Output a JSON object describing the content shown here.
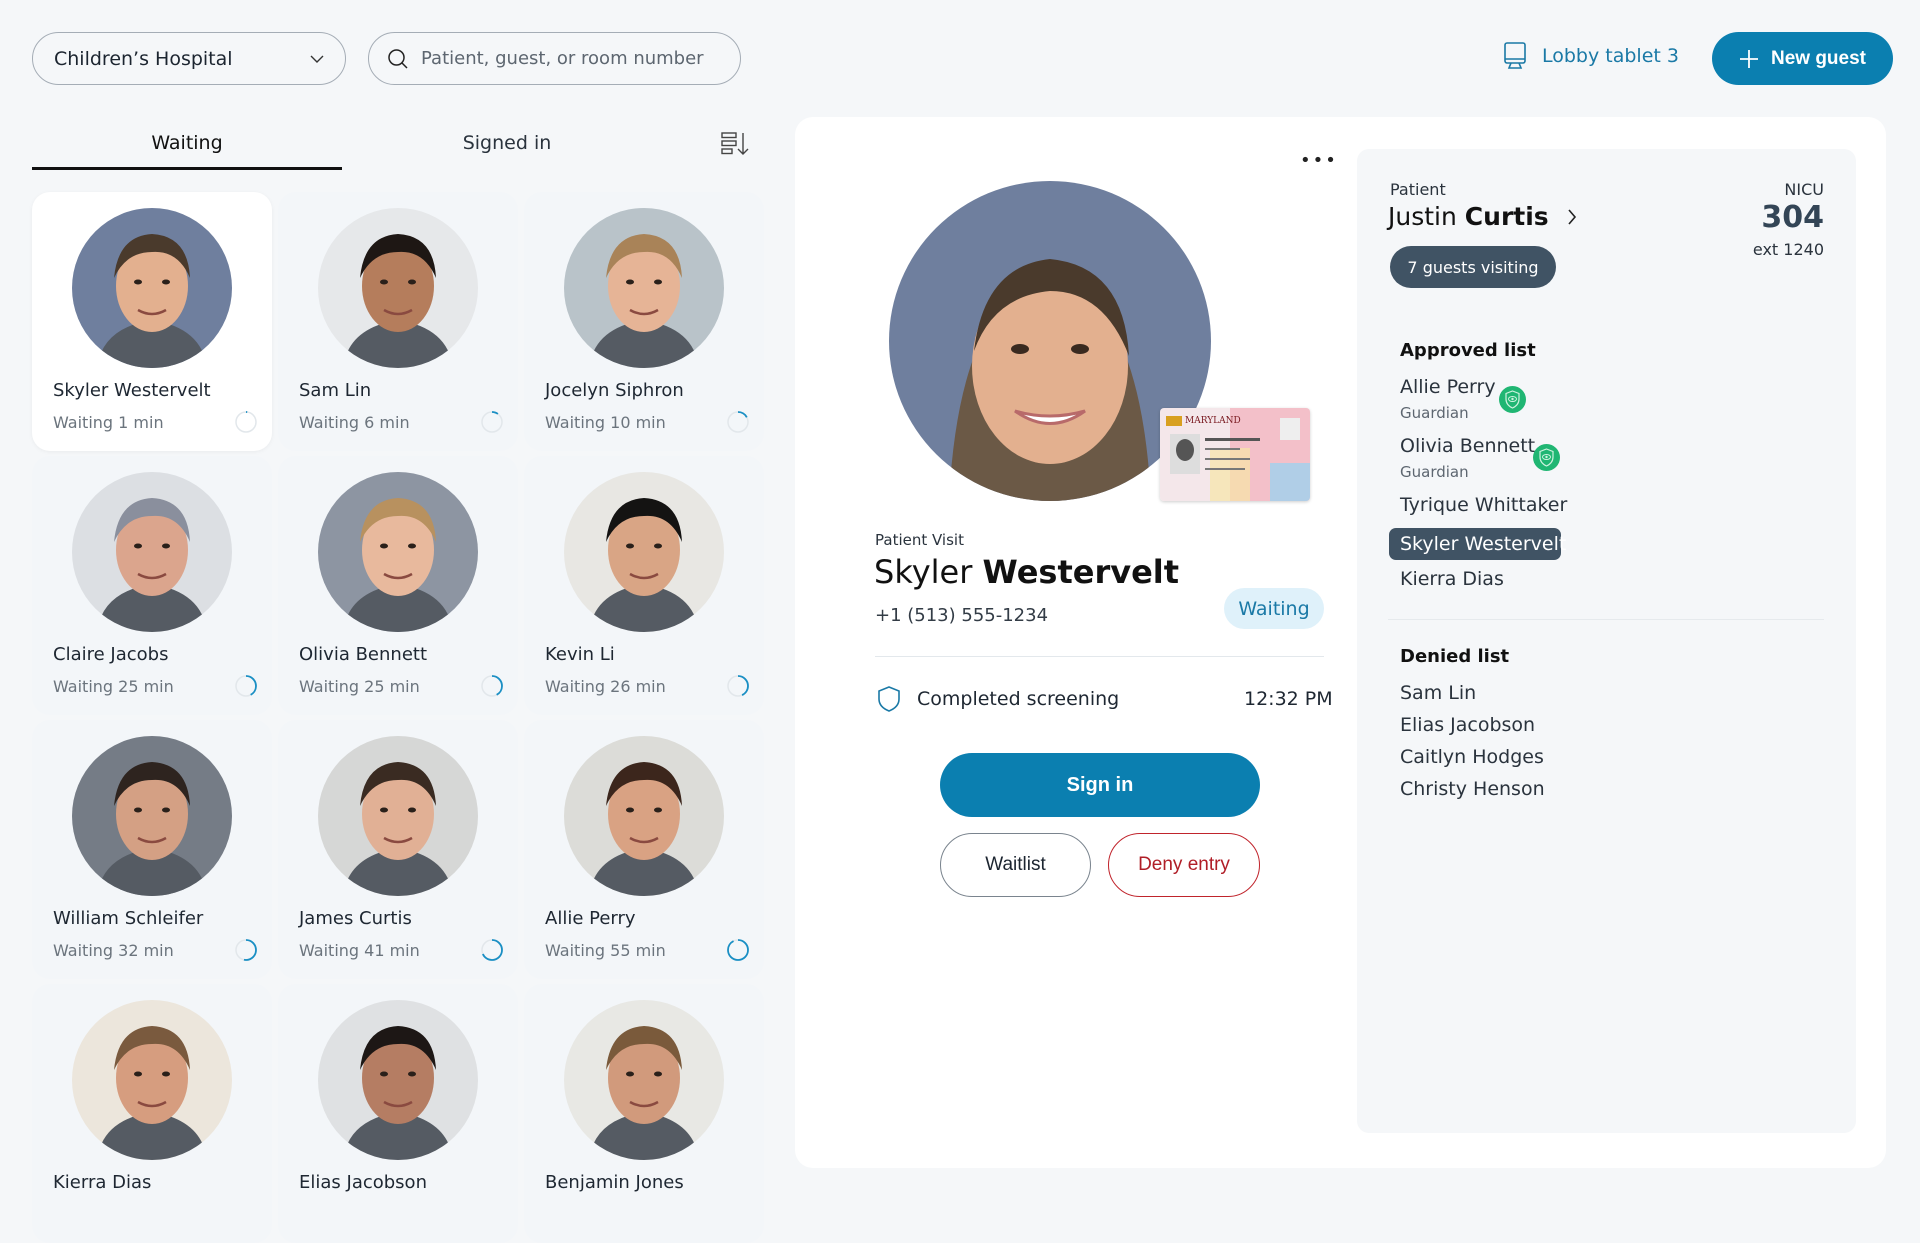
{
  "header": {
    "site_select": "Children’s Hospital",
    "search_placeholder": "Patient, guest, or room number",
    "device_label": "Lobby tablet 3",
    "new_guest_label": "New guest"
  },
  "tabs": [
    {
      "label": "Waiting",
      "active": true
    },
    {
      "label": "Signed in",
      "active": false
    }
  ],
  "guests": [
    {
      "name": "Skyler Westervelt",
      "wait": "Waiting 1 min",
      "progress": 0.02,
      "selected": true,
      "bg": "#6f7f9e",
      "skin": "#e3b08f",
      "hair": "#4a3a2c"
    },
    {
      "name": "Sam Lin",
      "wait": "Waiting 6 min",
      "progress": 0.1,
      "bg": "#e6e8ea",
      "skin": "#b57d5c",
      "hair": "#1e1714"
    },
    {
      "name": "Jocelyn Siphron",
      "wait": "Waiting 10 min",
      "progress": 0.17,
      "bg": "#b9c3c9",
      "skin": "#e6b496",
      "hair": "#a98358"
    },
    {
      "name": "Claire Jacobs",
      "wait": "Waiting 25 min",
      "progress": 0.42,
      "bg": "#dcdfe3",
      "skin": "#dba58d",
      "hair": "#8a8f9d"
    },
    {
      "name": "Olivia Bennett",
      "wait": "Waiting 25 min",
      "progress": 0.42,
      "bg": "#8d95a2",
      "skin": "#e8b99d",
      "hair": "#b8915f"
    },
    {
      "name": "Kevin Li",
      "wait": "Waiting 26 min",
      "progress": 0.43,
      "bg": "#e8e7e3",
      "skin": "#d9a585",
      "hair": "#141312"
    },
    {
      "name": "William Schleifer",
      "wait": "Waiting 32 min",
      "progress": 0.53,
      "bg": "#757c86",
      "skin": "#d4a084",
      "hair": "#2e241f"
    },
    {
      "name": "James Curtis",
      "wait": "Waiting 41 min",
      "progress": 0.68,
      "bg": "#d6d7d6",
      "skin": "#e1b095",
      "hair": "#3a2b22"
    },
    {
      "name": "Allie Perry",
      "wait": "Waiting 55 min",
      "progress": 0.92,
      "bg": "#dcdcd8",
      "skin": "#d9a283",
      "hair": "#3c261c"
    },
    {
      "name": "Kierra Dias",
      "wait": "",
      "progress": 0,
      "bg": "#ece6dc",
      "skin": "#d69d7f",
      "hair": "#7a5a3e"
    },
    {
      "name": "Elias Jacobson",
      "wait": "",
      "progress": 0,
      "bg": "#dfe1e3",
      "skin": "#b57d63",
      "hair": "#1d1715"
    },
    {
      "name": "Benjamin Jones",
      "wait": "",
      "progress": 0,
      "bg": "#e8e8e4",
      "skin": "#d19a7c",
      "hair": "#7a5a3b"
    }
  ],
  "visit": {
    "label": "Patient Visit",
    "first_name": "Skyler",
    "last_name": "Westervelt",
    "phone": "+1 (513) 555-1234",
    "status": "Waiting",
    "screening_label": "Completed screening",
    "screening_time": "12:32 PM",
    "id_card_state": "MARYLAND",
    "sign_in_label": "Sign in",
    "waitlist_label": "Waitlist",
    "deny_label": "Deny entry"
  },
  "patient": {
    "label": "Patient",
    "first_name": "Justin",
    "last_name": "Curtis",
    "guests_visiting": "7 guests visiting",
    "unit": "NICU",
    "room": "304",
    "ext": "ext 1240"
  },
  "approved": {
    "heading": "Approved list",
    "items": [
      {
        "name": "Allie Perry",
        "role": "Guardian",
        "verified": true
      },
      {
        "name": "Olivia Bennett",
        "role": "Guardian",
        "verified": true
      },
      {
        "name": "Tyrique Whittaker"
      },
      {
        "name": "Skyler Westervelt",
        "selected": true
      },
      {
        "name": "Kierra Dias"
      }
    ]
  },
  "denied": {
    "heading": "Denied list",
    "items": [
      "Sam Lin",
      "Elias Jacobson",
      "Caitlyn Hodges",
      "Christy Henson"
    ]
  },
  "colors": {
    "accent": "#0b7fb0",
    "accent_text": "#1a79a6",
    "danger": "#b01e27",
    "dark_pill": "#405364",
    "verified": "#20b673"
  }
}
